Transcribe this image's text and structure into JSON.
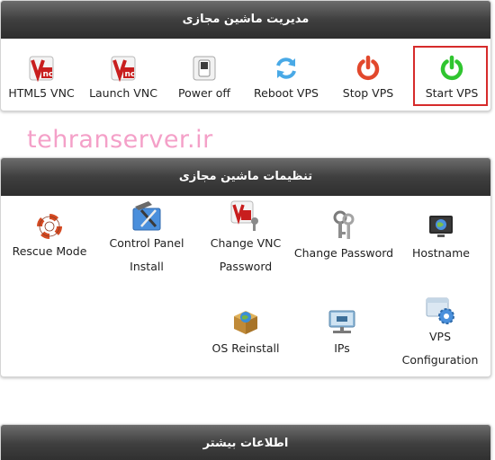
{
  "vm_management": {
    "title": "مدیریت ماشین مجازی",
    "actions": {
      "html5_vnc": "HTML5 VNC",
      "launch_vnc": "Launch VNC",
      "power_off": "Power off",
      "reboot_vps": "Reboot VPS",
      "stop_vps": "Stop VPS",
      "start_vps": "Start VPS"
    },
    "selected_action": "start_vps"
  },
  "watermark": "tehranserver.ir",
  "vm_settings": {
    "title": "تنظیمات ماشین مجازی",
    "actions": {
      "rescue_mode": "Rescue Mode",
      "control_panel_1": "Control Panel",
      "control_panel_2": "Install",
      "change_vnc_1": "Change VNC",
      "change_vnc_2": "Password",
      "change_password": "Change Password",
      "hostname": "Hostname",
      "os_reinstall": "OS Reinstall",
      "ips": "IPs",
      "vps_config_1": "VPS",
      "vps_config_2": "Configuration"
    }
  },
  "more_info": {
    "title": "اطلاعات بیشتر"
  },
  "colors": {
    "header_dark": "#2e2e2e",
    "stop_red": "#e2482c",
    "start_green": "#2fc52f",
    "reboot_blue": "#49a9e6",
    "highlight": "#d62b2b",
    "watermark": "#f4a0c8"
  }
}
